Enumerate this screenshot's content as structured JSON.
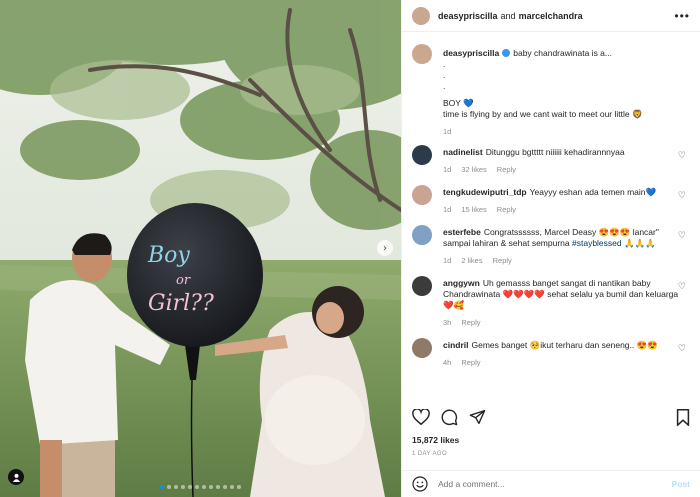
{
  "header": {
    "user1": "deasypriscilla",
    "and": "and",
    "user2": "marcelchandra",
    "more": "•••"
  },
  "photo": {
    "balloon_line1": "Boy",
    "balloon_line2": "or",
    "balloon_line3": "Girl??",
    "carousel_total": 12,
    "carousel_active": 0
  },
  "caption": {
    "user": "deasypriscilla",
    "verified_icon": "verified-badge-icon",
    "line1": "baby chandrawinata is a...",
    "line2": ".",
    "line3": ".",
    "line4": ".",
    "line5": "BOY 💙",
    "line6": "time is flying by and we cant wait to meet our little 🦁",
    "time": "1d"
  },
  "comments": [
    {
      "user": "nadinelist",
      "text": "Ditunggu bgttttt niiiiii kehadirannnyaa",
      "time": "1d",
      "likes": "32 likes",
      "reply": "Reply",
      "avatar_color": "#2d3a4a"
    },
    {
      "user": "tengkudewiputri_tdp",
      "text": "Yeayyy eshan ada temen main💙",
      "time": "1d",
      "likes": "15 likes",
      "reply": "Reply",
      "avatar_color": "#c7a493"
    },
    {
      "user": "esterfebe",
      "text": "Congratssssss, Marcel Deasy 😍😍😍 lancar\" sampai lahiran & sehat sempurna",
      "hashtag": "#stayblessed",
      "text_after": " 🙏🙏🙏",
      "time": "1d",
      "likes": "2 likes",
      "reply": "Reply",
      "avatar_color": "#7ea1c4"
    },
    {
      "user": "anggywn",
      "text": "Uh gemasss banget sangat di nantikan baby Chandrawinata ❤️❤️❤️❤️ sehat selalu ya bumil dan keluarga ❤️🥰",
      "time": "3h",
      "likes": "",
      "reply": "Reply",
      "avatar_color": "#3b3b3b"
    },
    {
      "user": "cindril",
      "text": "Gemes banget 🥺ikut terharu dan seneng.. 😍😍",
      "time": "4h",
      "likes": "",
      "reply": "Reply",
      "avatar_color": "#8f7a6a"
    }
  ],
  "actions": {
    "like_icon": "heart-icon",
    "comment_icon": "comment-icon",
    "share_icon": "share-icon",
    "save_icon": "bookmark-icon"
  },
  "likes": "15,872 likes",
  "posted": "1 DAY AGO",
  "add_comment": {
    "placeholder": "Add a comment...",
    "post_label": "Post"
  }
}
